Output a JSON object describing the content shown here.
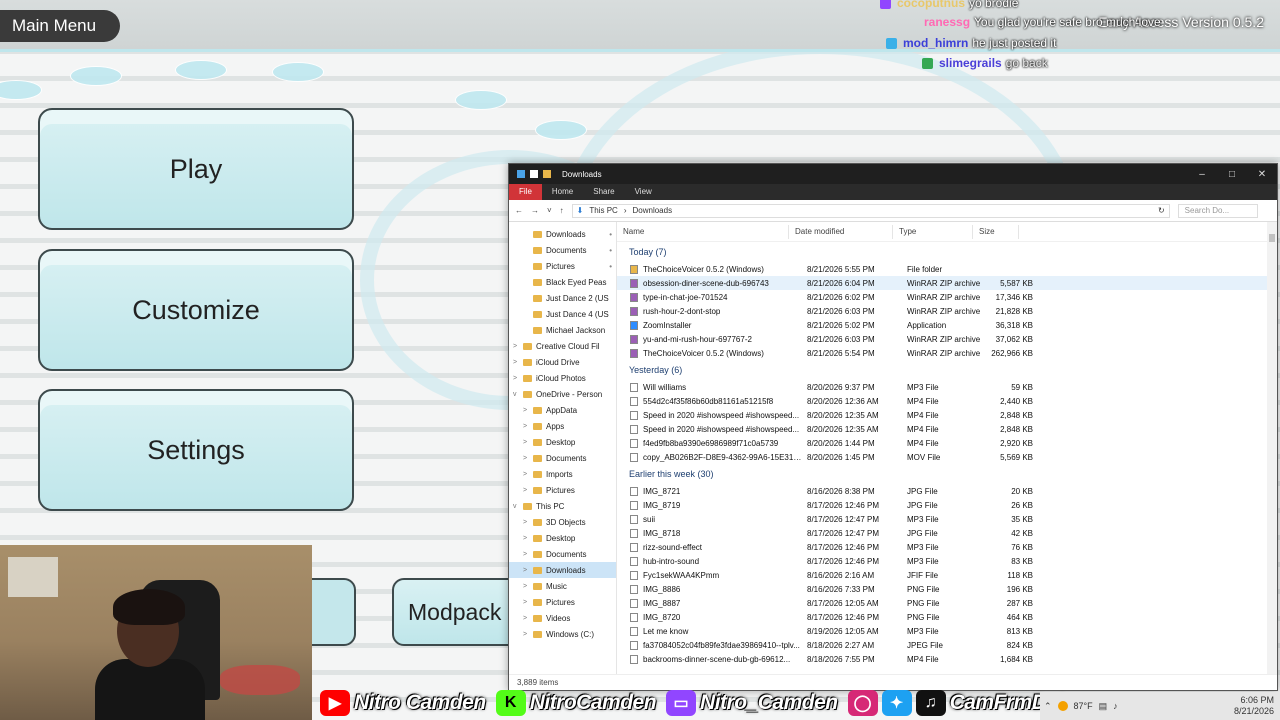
{
  "game": {
    "menu_title": "Main Menu",
    "version": "Early Access Version 0.5.2",
    "buttons": {
      "play": "Play",
      "customize": "Customize",
      "settings": "Settings",
      "modpack": "Modpack"
    }
  },
  "chat": [
    {
      "user": "cocoputnus",
      "message": "yo brodie",
      "user_color": "#e8c86a",
      "badge_color": "#9146ff"
    },
    {
      "user": "ranessg",
      "message": "You glad you're safe bro much love",
      "user_color": "#ff69b4",
      "badge_color": ""
    },
    {
      "user": "mod_himrn",
      "message": "he just posted it",
      "user_color": "#3b3fd8",
      "badge_color": "#3ab0e8"
    },
    {
      "user": "slimegrails",
      "message": "go back",
      "user_color": "#4a3fd8",
      "badge_color": "#34a853"
    }
  ],
  "social": {
    "youtube": "Nitro Camden",
    "kick": "NitroCamden",
    "twitch": "Nitro_Camden",
    "ig_twitter_tiktok": "CamFrmDaLou"
  },
  "tray": {
    "weather": "87°F",
    "time": "6:06 PM",
    "date": "8/21/2026"
  },
  "explorer": {
    "title": "Downloads",
    "ribbon_tabs": [
      "File",
      "Home",
      "Share",
      "View"
    ],
    "path": [
      "This PC",
      "Downloads"
    ],
    "search_placeholder": "Search Do...",
    "columns": [
      "Name",
      "Date modified",
      "Type",
      "Size"
    ],
    "nav": [
      {
        "label": "Downloads",
        "pinned": true,
        "indent": 1,
        "exp": ""
      },
      {
        "label": "Documents",
        "pinned": true,
        "indent": 1,
        "exp": ""
      },
      {
        "label": "Pictures",
        "pinned": true,
        "indent": 1,
        "exp": ""
      },
      {
        "label": "Black Eyed Peas",
        "indent": 1,
        "exp": ""
      },
      {
        "label": "Just Dance 2 (US",
        "indent": 1,
        "exp": ""
      },
      {
        "label": "Just Dance 4 (US",
        "indent": 1,
        "exp": ""
      },
      {
        "label": "Michael Jackson",
        "indent": 1,
        "exp": ""
      },
      {
        "label": "Creative Cloud Fil",
        "indent": 0,
        "exp": ">"
      },
      {
        "label": "iCloud Drive",
        "indent": 0,
        "exp": ">"
      },
      {
        "label": "iCloud Photos",
        "indent": 0,
        "exp": ">"
      },
      {
        "label": "OneDrive - Person",
        "indent": 0,
        "exp": "v"
      },
      {
        "label": "AppData",
        "indent": 1,
        "exp": ">"
      },
      {
        "label": "Apps",
        "indent": 1,
        "exp": ">"
      },
      {
        "label": "Desktop",
        "indent": 1,
        "exp": ">"
      },
      {
        "label": "Documents",
        "indent": 1,
        "exp": ">"
      },
      {
        "label": "Imports",
        "indent": 1,
        "exp": ">"
      },
      {
        "label": "Pictures",
        "indent": 1,
        "exp": ">"
      },
      {
        "label": "This PC",
        "indent": 0,
        "exp": "v"
      },
      {
        "label": "3D Objects",
        "indent": 1,
        "exp": ">"
      },
      {
        "label": "Desktop",
        "indent": 1,
        "exp": ">"
      },
      {
        "label": "Documents",
        "indent": 1,
        "exp": ">"
      },
      {
        "label": "Downloads",
        "indent": 1,
        "exp": ">",
        "selected": true
      },
      {
        "label": "Music",
        "indent": 1,
        "exp": ">"
      },
      {
        "label": "Pictures",
        "indent": 1,
        "exp": ">"
      },
      {
        "label": "Videos",
        "indent": 1,
        "exp": ">"
      },
      {
        "label": "Windows (C:)",
        "indent": 1,
        "exp": ">"
      }
    ],
    "groups": [
      {
        "label": "Today (7)",
        "files": [
          {
            "name": "TheChoiceVoicer 0.5.2 (Windows)",
            "date": "8/21/2026 5:55 PM",
            "type": "File folder",
            "size": "",
            "icon": "folder"
          },
          {
            "name": "obsession-diner-scene-dub-696743",
            "date": "8/21/2026 6:04 PM",
            "type": "WinRAR ZIP archive",
            "size": "5,587 KB",
            "icon": "zip",
            "selected": true
          },
          {
            "name": "type-in-chat-joe-701524",
            "date": "8/21/2026 6:02 PM",
            "type": "WinRAR ZIP archive",
            "size": "17,346 KB",
            "icon": "zip"
          },
          {
            "name": "rush-hour-2-dont-stop",
            "date": "8/21/2026 6:03 PM",
            "type": "WinRAR ZIP archive",
            "size": "21,828 KB",
            "icon": "zip"
          },
          {
            "name": "ZoomInstaller",
            "date": "8/21/2026 5:02 PM",
            "type": "Application",
            "size": "36,318 KB",
            "icon": "app"
          },
          {
            "name": "yu-and-mi-rush-hour-697767-2",
            "date": "8/21/2026 6:03 PM",
            "type": "WinRAR ZIP archive",
            "size": "37,062 KB",
            "icon": "zip"
          },
          {
            "name": "TheChoiceVoicer 0.5.2 (Windows)",
            "date": "8/21/2026 5:54 PM",
            "type": "WinRAR ZIP archive",
            "size": "262,966 KB",
            "icon": "zip"
          }
        ]
      },
      {
        "label": "Yesterday (6)",
        "files": [
          {
            "name": "Will williams",
            "date": "8/20/2026 9:37 PM",
            "type": "MP3 File",
            "size": "59 KB",
            "icon": "file"
          },
          {
            "name": "554d2c4f35f86b60db81161a51215f8",
            "date": "8/20/2026 12:36 AM",
            "type": "MP4 File",
            "size": "2,440 KB",
            "icon": "file"
          },
          {
            "name": "Speed in 2020 #ishowspeed #ishowspeed...",
            "date": "8/20/2026 12:35 AM",
            "type": "MP4 File",
            "size": "2,848 KB",
            "icon": "file"
          },
          {
            "name": "Speed in 2020 #ishowspeed #ishowspeed...",
            "date": "8/20/2026 12:35 AM",
            "type": "MP4 File",
            "size": "2,848 KB",
            "icon": "file"
          },
          {
            "name": "f4ed9fb8ba9390e6986989f71c0a5739",
            "date": "8/20/2026 1:44 PM",
            "type": "MP4 File",
            "size": "2,920 KB",
            "icon": "file"
          },
          {
            "name": "copy_AB026B2F-D8E9-4362-99A6-15E319...",
            "date": "8/20/2026 1:45 PM",
            "type": "MOV File",
            "size": "5,569 KB",
            "icon": "file"
          }
        ]
      },
      {
        "label": "Earlier this week (30)",
        "files": [
          {
            "name": "IMG_8721",
            "date": "8/16/2026 8:38 PM",
            "type": "JPG File",
            "size": "20 KB",
            "icon": "file"
          },
          {
            "name": "IMG_8719",
            "date": "8/17/2026 12:46 PM",
            "type": "JPG File",
            "size": "26 KB",
            "icon": "file"
          },
          {
            "name": "suii",
            "date": "8/17/2026 12:47 PM",
            "type": "MP3 File",
            "size": "35 KB",
            "icon": "file"
          },
          {
            "name": "IMG_8718",
            "date": "8/17/2026 12:47 PM",
            "type": "JPG File",
            "size": "42 KB",
            "icon": "file"
          },
          {
            "name": "rizz-sound-effect",
            "date": "8/17/2026 12:46 PM",
            "type": "MP3 File",
            "size": "76 KB",
            "icon": "file"
          },
          {
            "name": "hub-intro-sound",
            "date": "8/17/2026 12:46 PM",
            "type": "MP3 File",
            "size": "83 KB",
            "icon": "file"
          },
          {
            "name": "Fyc1sekWAA4KPmm",
            "date": "8/16/2026 2:16 AM",
            "type": "JFIF File",
            "size": "118 KB",
            "icon": "file"
          },
          {
            "name": "IMG_8886",
            "date": "8/16/2026 7:33 PM",
            "type": "PNG File",
            "size": "196 KB",
            "icon": "file"
          },
          {
            "name": "IMG_8887",
            "date": "8/17/2026 12:05 AM",
            "type": "PNG File",
            "size": "287 KB",
            "icon": "file"
          },
          {
            "name": "IMG_8720",
            "date": "8/17/2026 12:46 PM",
            "type": "PNG File",
            "size": "464 KB",
            "icon": "file"
          },
          {
            "name": "Let me know",
            "date": "8/19/2026 12:05 AM",
            "type": "MP3 File",
            "size": "813 KB",
            "icon": "file"
          },
          {
            "name": "fa37084052c04fb89fe3fdae39869410--tplv...",
            "date": "8/18/2026 2:27 AM",
            "type": "JPEG File",
            "size": "824 KB",
            "icon": "file"
          },
          {
            "name": "backrooms-dinner-scene-dub-gb-69612...",
            "date": "8/18/2026 7:55 PM",
            "type": "MP4 File",
            "size": "1,684 KB",
            "icon": "file"
          }
        ]
      }
    ],
    "status": "3,889 items"
  }
}
